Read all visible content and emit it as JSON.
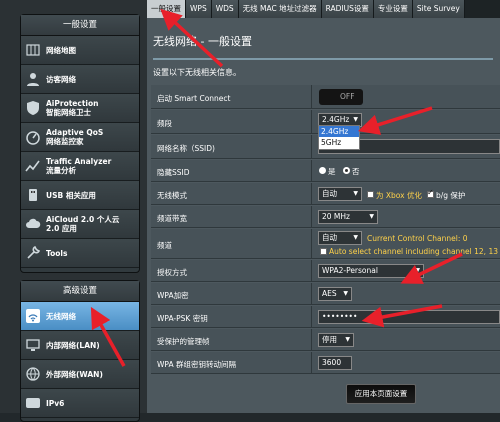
{
  "sidebar": {
    "general_title": "一般设置",
    "general_items": [
      {
        "label": "网络地图",
        "icon": "map-icon"
      },
      {
        "label": "访客网络",
        "icon": "guest-icon"
      },
      {
        "label": "AiProtection\n智能网络卫士",
        "icon": "shield-icon"
      },
      {
        "label": "Adaptive QoS\n网络监控家",
        "icon": "qos-icon"
      },
      {
        "label": "Traffic Analyzer\n流量分析",
        "icon": "chart-icon"
      },
      {
        "label": "USB 相关应用",
        "icon": "usb-icon"
      },
      {
        "label": "AiCloud 2.0 个人云\n2.0 应用",
        "icon": "cloud-icon"
      },
      {
        "label": "Tools",
        "icon": "tools-icon"
      }
    ],
    "advanced_title": "高级设置",
    "advanced_items": [
      {
        "label": "无线网络",
        "icon": "wifi-icon"
      },
      {
        "label": "内部网络(LAN)",
        "icon": "lan-icon"
      },
      {
        "label": "外部网络(WAN)",
        "icon": "globe-icon"
      },
      {
        "label": "IPv6",
        "icon": "ipv6-icon"
      }
    ]
  },
  "tabs": [
    "一般设置",
    "WPS",
    "WDS",
    "无线 MAC 地址过滤器",
    "RADIUS设置",
    "专业设置",
    "Site Survey"
  ],
  "page": {
    "title": "无线网络 - 一般设置",
    "description": "设置以下无线相关信息。"
  },
  "form": {
    "smart_connect": {
      "label": "启动 Smart Connect",
      "value": "OFF"
    },
    "band": {
      "label": "频段",
      "value": "2.4GHz",
      "options": [
        "2.4GHz",
        "5GHz"
      ]
    },
    "ssid": {
      "label": "网络名称（SSID)"
    },
    "hide_ssid": {
      "label": "隐藏SSID",
      "yes": "是",
      "no": "否"
    },
    "wireless_mode": {
      "label": "无线模式",
      "value": "自动",
      "xbox": "为 Xbox 优化",
      "bg": "b/g 保护"
    },
    "bandwidth": {
      "label": "频道带宽",
      "value": "20 MHz"
    },
    "channel": {
      "label": "频道",
      "value": "自动",
      "current": "Current Control Channel: 0",
      "auto_note": "Auto select channel including channel 12, 13"
    },
    "auth": {
      "label": "授权方式",
      "value": "WPA2-Personal"
    },
    "wpa_enc": {
      "label": "WPA加密",
      "value": "AES"
    },
    "psk": {
      "label": "WPA-PSK 密钥",
      "value": "••••••••"
    },
    "pmf": {
      "label": "受保护的管理帧",
      "value": "停用"
    },
    "rekey": {
      "label": "WPA 群组密钥转动间隔",
      "value": "3600"
    }
  },
  "apply_label": "应用本页面设置",
  "colors": {
    "accent": "#4a8ec4",
    "arrow": "#e8202a"
  }
}
